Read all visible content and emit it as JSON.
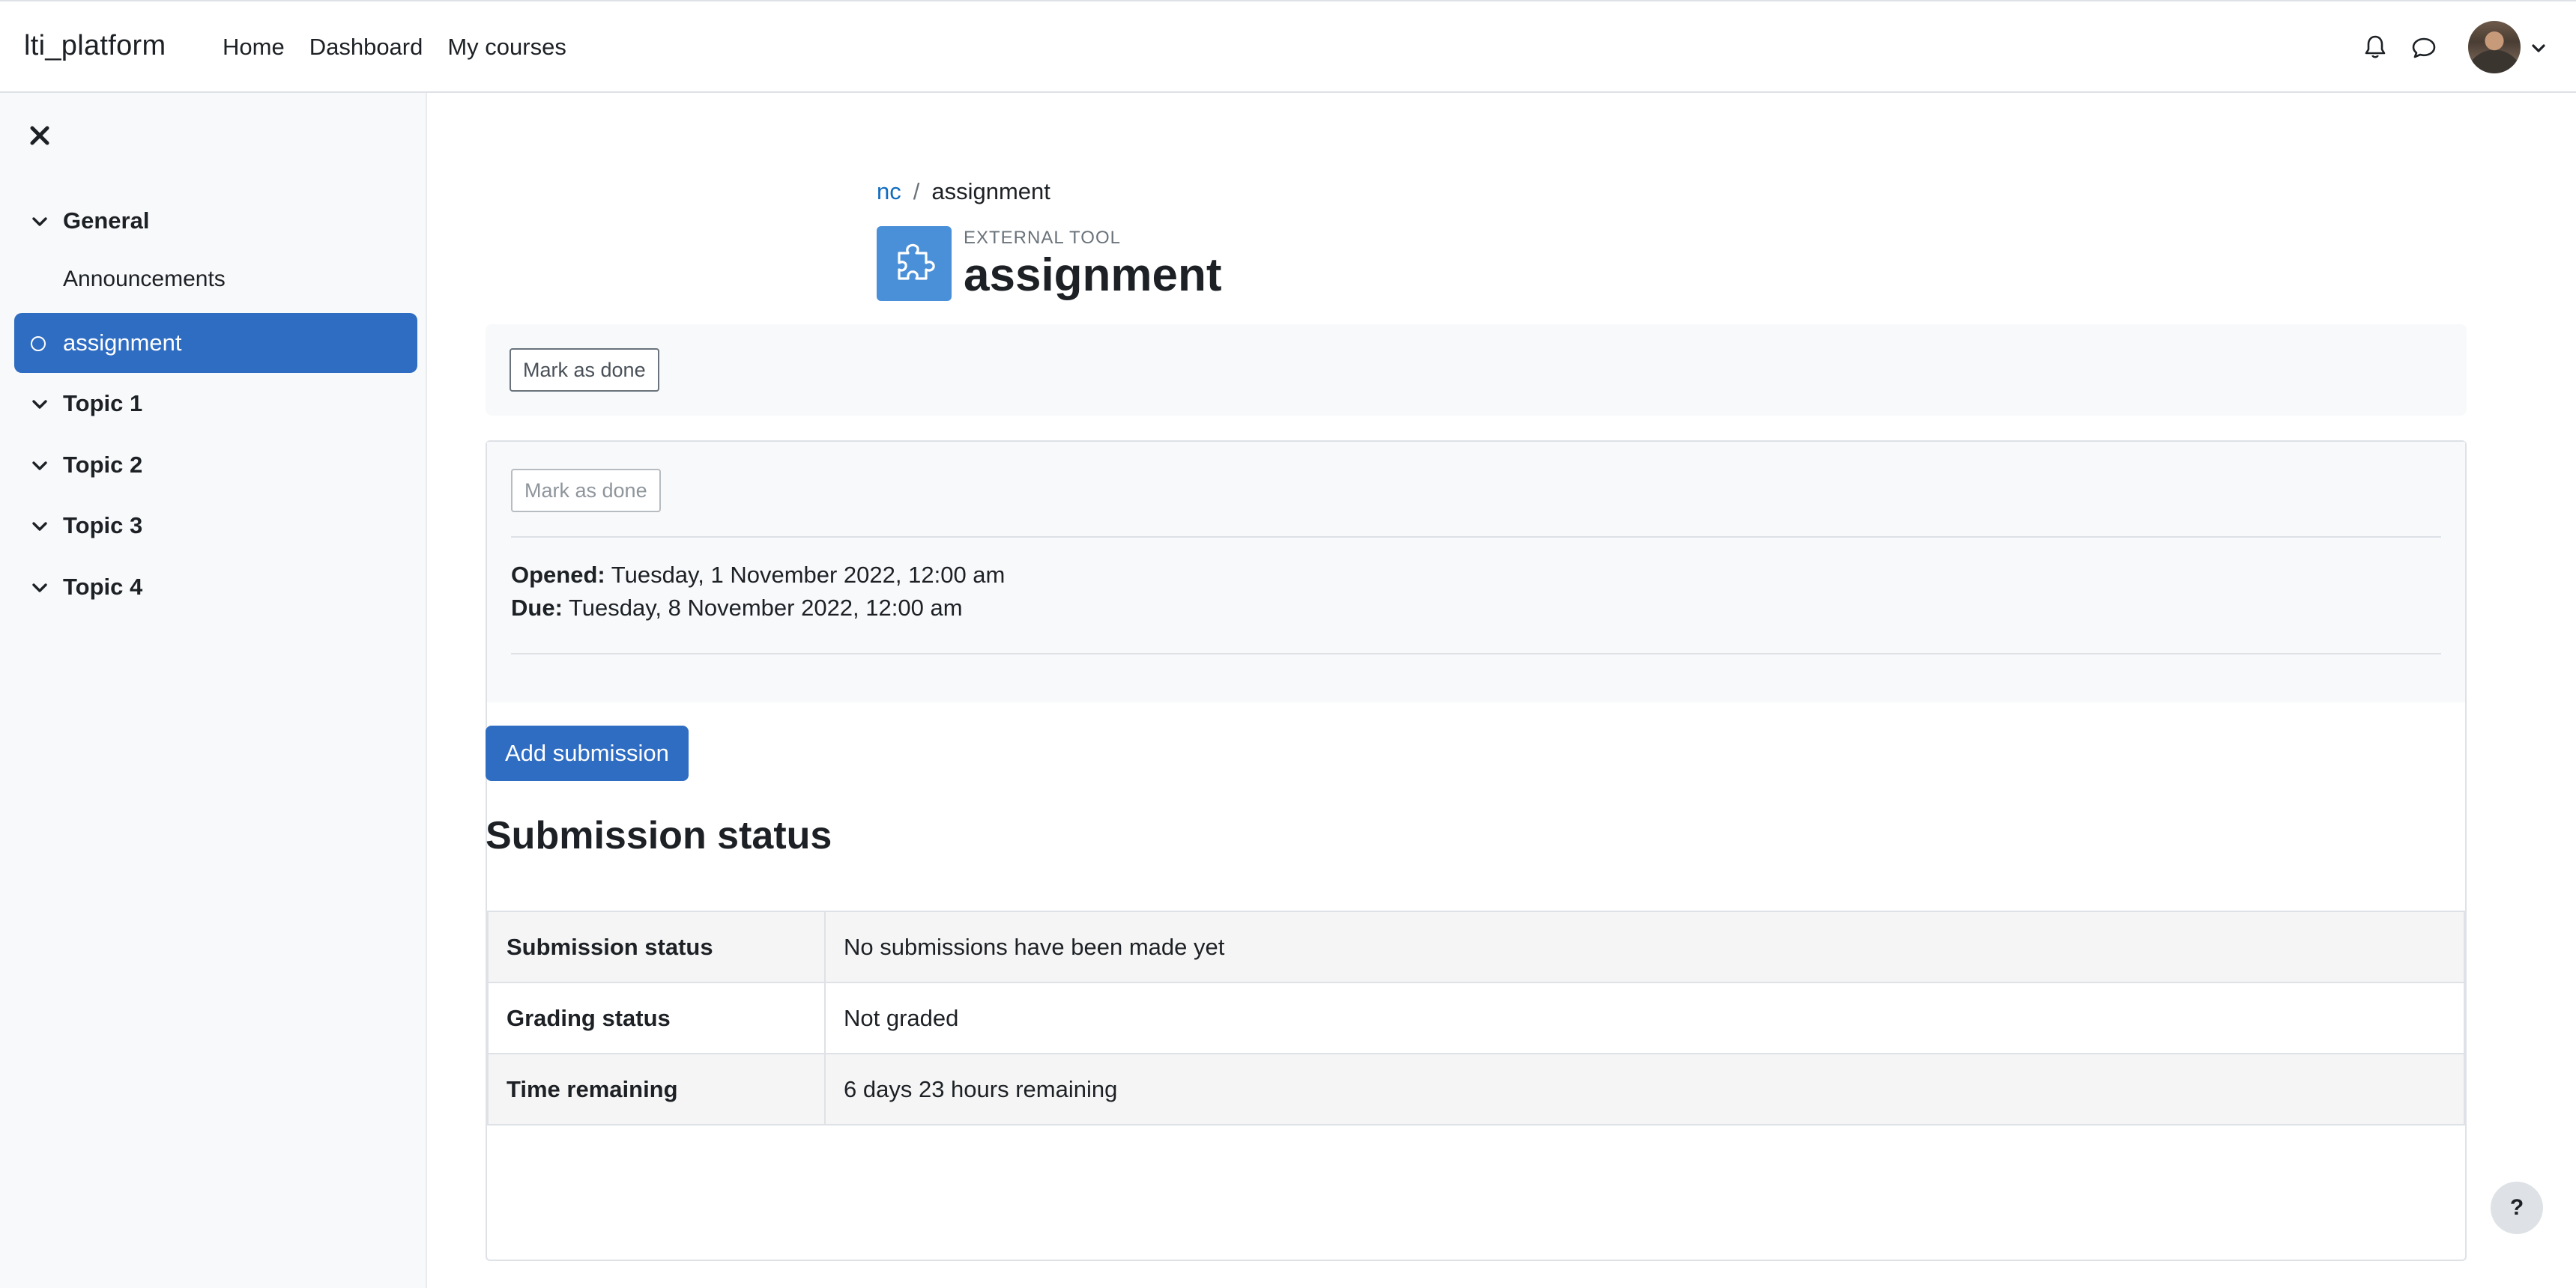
{
  "navbar": {
    "brand": "lti_platform",
    "links": [
      "Home",
      "Dashboard",
      "My courses"
    ]
  },
  "drawer": {
    "sections": [
      {
        "label": "General"
      },
      {
        "label": "Topic 1"
      },
      {
        "label": "Topic 2"
      },
      {
        "label": "Topic 3"
      },
      {
        "label": "Topic 4"
      }
    ],
    "activities": [
      "Announcements",
      "assignment"
    ],
    "active_activity": "assignment"
  },
  "breadcrumb": {
    "parent": "nc",
    "separator": "/",
    "current": "assignment"
  },
  "header": {
    "module_type": "EXTERNAL TOOL",
    "title": "assignment"
  },
  "completion": {
    "button_label": "Mark as done",
    "card_button_label": "Mark as done"
  },
  "dates": {
    "opened_label": "Opened:",
    "opened_value": "Tuesday, 1 November 2022, 12:00 am",
    "due_label": "Due:",
    "due_value": "Tuesday, 8 November 2022, 12:00 am"
  },
  "actions": {
    "add_submission": "Add submission"
  },
  "submission": {
    "heading": "Submission status",
    "rows": [
      {
        "label": "Submission status",
        "value": "No submissions have been made yet"
      },
      {
        "label": "Grading status",
        "value": "Not graded"
      },
      {
        "label": "Time remaining",
        "value": "6 days 23 hours remaining"
      }
    ]
  },
  "help": {
    "label": "?"
  },
  "colors": {
    "primary": "#2f6dc2",
    "link": "#0f6cbf",
    "activity_icon": "#4a90d9"
  }
}
